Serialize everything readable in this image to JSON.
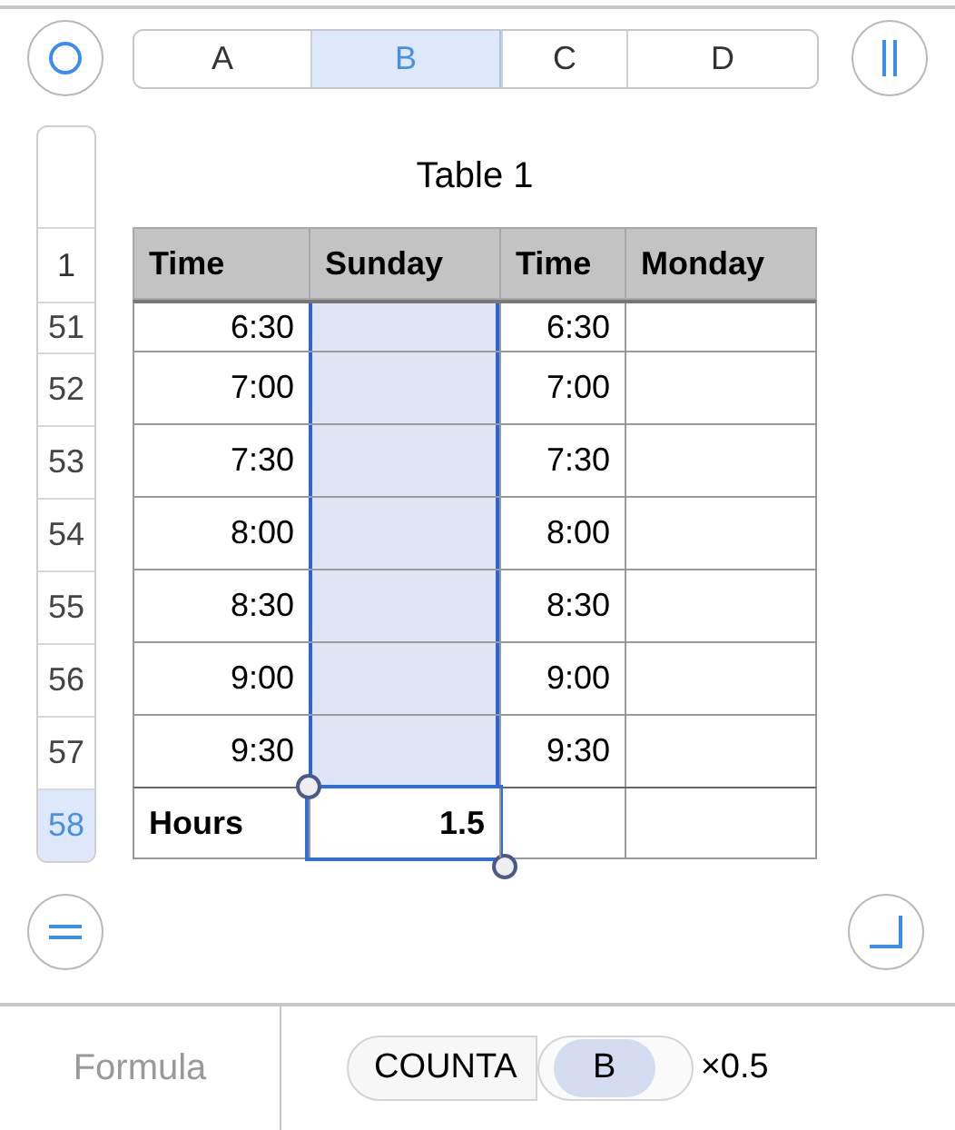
{
  "columns": [
    {
      "label": "A",
      "selected": false
    },
    {
      "label": "B",
      "selected": true
    },
    {
      "label": "C",
      "selected": false
    },
    {
      "label": "D",
      "selected": false
    }
  ],
  "table": {
    "title": "Table 1",
    "header_row_number": "1",
    "header": [
      "Time",
      "Sunday",
      "Time",
      "Monday"
    ],
    "rows": [
      {
        "number": "51",
        "cells": [
          "6:30",
          "",
          "6:30",
          ""
        ]
      },
      {
        "number": "52",
        "cells": [
          "7:00",
          "",
          "7:00",
          ""
        ]
      },
      {
        "number": "53",
        "cells": [
          "7:30",
          "",
          "7:30",
          ""
        ]
      },
      {
        "number": "54",
        "cells": [
          "8:00",
          "",
          "8:00",
          ""
        ]
      },
      {
        "number": "55",
        "cells": [
          "8:30",
          "",
          "8:30",
          ""
        ]
      },
      {
        "number": "56",
        "cells": [
          "9:00",
          "",
          "9:00",
          ""
        ]
      },
      {
        "number": "57",
        "cells": [
          "9:30",
          "",
          "9:30",
          ""
        ]
      }
    ],
    "footer": {
      "number": "58",
      "selected": true,
      "cells": [
        {
          "text": "Hours",
          "selected": false
        },
        {
          "text": "1.5",
          "selected": true
        },
        {
          "text": "",
          "selected": false
        },
        {
          "text": "",
          "selected": false
        }
      ]
    }
  },
  "formula_bar": {
    "label": "Formula",
    "tokens": [
      {
        "kind": "function",
        "text": "COUNTA"
      },
      {
        "kind": "reference",
        "text": "B"
      },
      {
        "kind": "operator",
        "text": "×0.5"
      }
    ]
  }
}
